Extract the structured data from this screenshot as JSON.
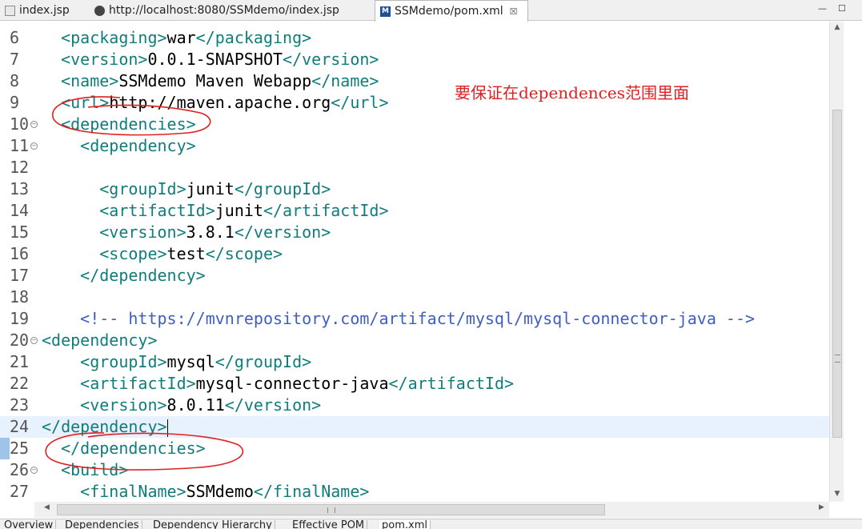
{
  "tabs": [
    {
      "label": "index.jsp",
      "icon": "jsp-file-icon"
    },
    {
      "label": "http://localhost:8080/SSMdemo/index.jsp",
      "icon": "globe-icon"
    },
    {
      "label": "SSMdemo/pom.xml",
      "icon": "maven-file-icon",
      "active": true,
      "close": "☒"
    }
  ],
  "window_controls": {
    "minimize": "—",
    "maximize": "☐"
  },
  "editor": {
    "lines": [
      {
        "n": "6",
        "indent": "  ",
        "open": "<packaging>",
        "text": "war",
        "close": "</packaging>"
      },
      {
        "n": "7",
        "indent": "  ",
        "open": "<version>",
        "text": "0.0.1-SNAPSHOT",
        "close": "</version>"
      },
      {
        "n": "8",
        "indent": "  ",
        "open": "<name>",
        "text": "SSMdemo Maven Webapp",
        "close": "</name>"
      },
      {
        "n": "9",
        "indent": "  ",
        "open": "<url>",
        "text": "http://maven.apache.org",
        "close": "</url>"
      },
      {
        "n": "10",
        "fold": true,
        "indent": "  ",
        "open": "<dependencies>",
        "text": "",
        "close": ""
      },
      {
        "n": "11",
        "fold": true,
        "indent": "    ",
        "open": "<dependency>",
        "text": "",
        "close": ""
      },
      {
        "n": "12",
        "indent": "",
        "open": "",
        "text": "",
        "close": ""
      },
      {
        "n": "13",
        "indent": "      ",
        "open": "<groupId>",
        "text": "junit",
        "close": "</groupId>"
      },
      {
        "n": "14",
        "indent": "      ",
        "open": "<artifactId>",
        "text": "junit",
        "close": "</artifactId>"
      },
      {
        "n": "15",
        "indent": "      ",
        "open": "<version>",
        "text": "3.8.1",
        "close": "</version>"
      },
      {
        "n": "16",
        "indent": "      ",
        "open": "<scope>",
        "text": "test",
        "close": "</scope>"
      },
      {
        "n": "17",
        "indent": "    ",
        "open": "</dependency>",
        "text": "",
        "close": ""
      },
      {
        "n": "18",
        "indent": "",
        "open": "",
        "text": "",
        "close": ""
      },
      {
        "n": "19",
        "indent": "    ",
        "comment": "<!-- https://mvnrepository.com/artifact/mysql/mysql-connector-java -->"
      },
      {
        "n": "20",
        "fold": true,
        "indent": "",
        "open": "<dependency>",
        "text": "",
        "close": ""
      },
      {
        "n": "21",
        "indent": "    ",
        "open": "<groupId>",
        "text": "mysql",
        "close": "</groupId>"
      },
      {
        "n": "22",
        "indent": "    ",
        "open": "<artifactId>",
        "text": "mysql-connector-java",
        "close": "</artifactId>"
      },
      {
        "n": "23",
        "indent": "    ",
        "open": "<version>",
        "text": "8.0.11",
        "close": "</version>"
      },
      {
        "n": "24",
        "indent": "",
        "open": "</dependency>",
        "text": "",
        "close": "",
        "current": true,
        "caret": true
      },
      {
        "n": "25",
        "indent": "  ",
        "open": "</dependencies>",
        "text": "",
        "close": ""
      },
      {
        "n": "26",
        "fold": true,
        "indent": "  ",
        "open": "<build>",
        "text": "",
        "close": ""
      },
      {
        "n": "27",
        "indent": "    ",
        "open": "<finalName>",
        "text": "SSMdemo",
        "close": "</finalName>"
      }
    ]
  },
  "annotation": {
    "text": "要保证在dependences范围里面",
    "color": "#e02020"
  },
  "bottom_tabs": [
    {
      "label": "Overview"
    },
    {
      "label": "Dependencies"
    },
    {
      "label": "Dependency Hierarchy"
    },
    {
      "label": "Effective POM"
    },
    {
      "label": "pom.xml",
      "active": true
    }
  ],
  "scrollbar_arrows": {
    "up": "▲",
    "down": "▼",
    "left": "◀",
    "right": "▶"
  },
  "colors": {
    "tag": "#117c7c",
    "comment": "#3f5fbf",
    "current_line": "#e8f2fe",
    "annotation": "#e02020"
  }
}
